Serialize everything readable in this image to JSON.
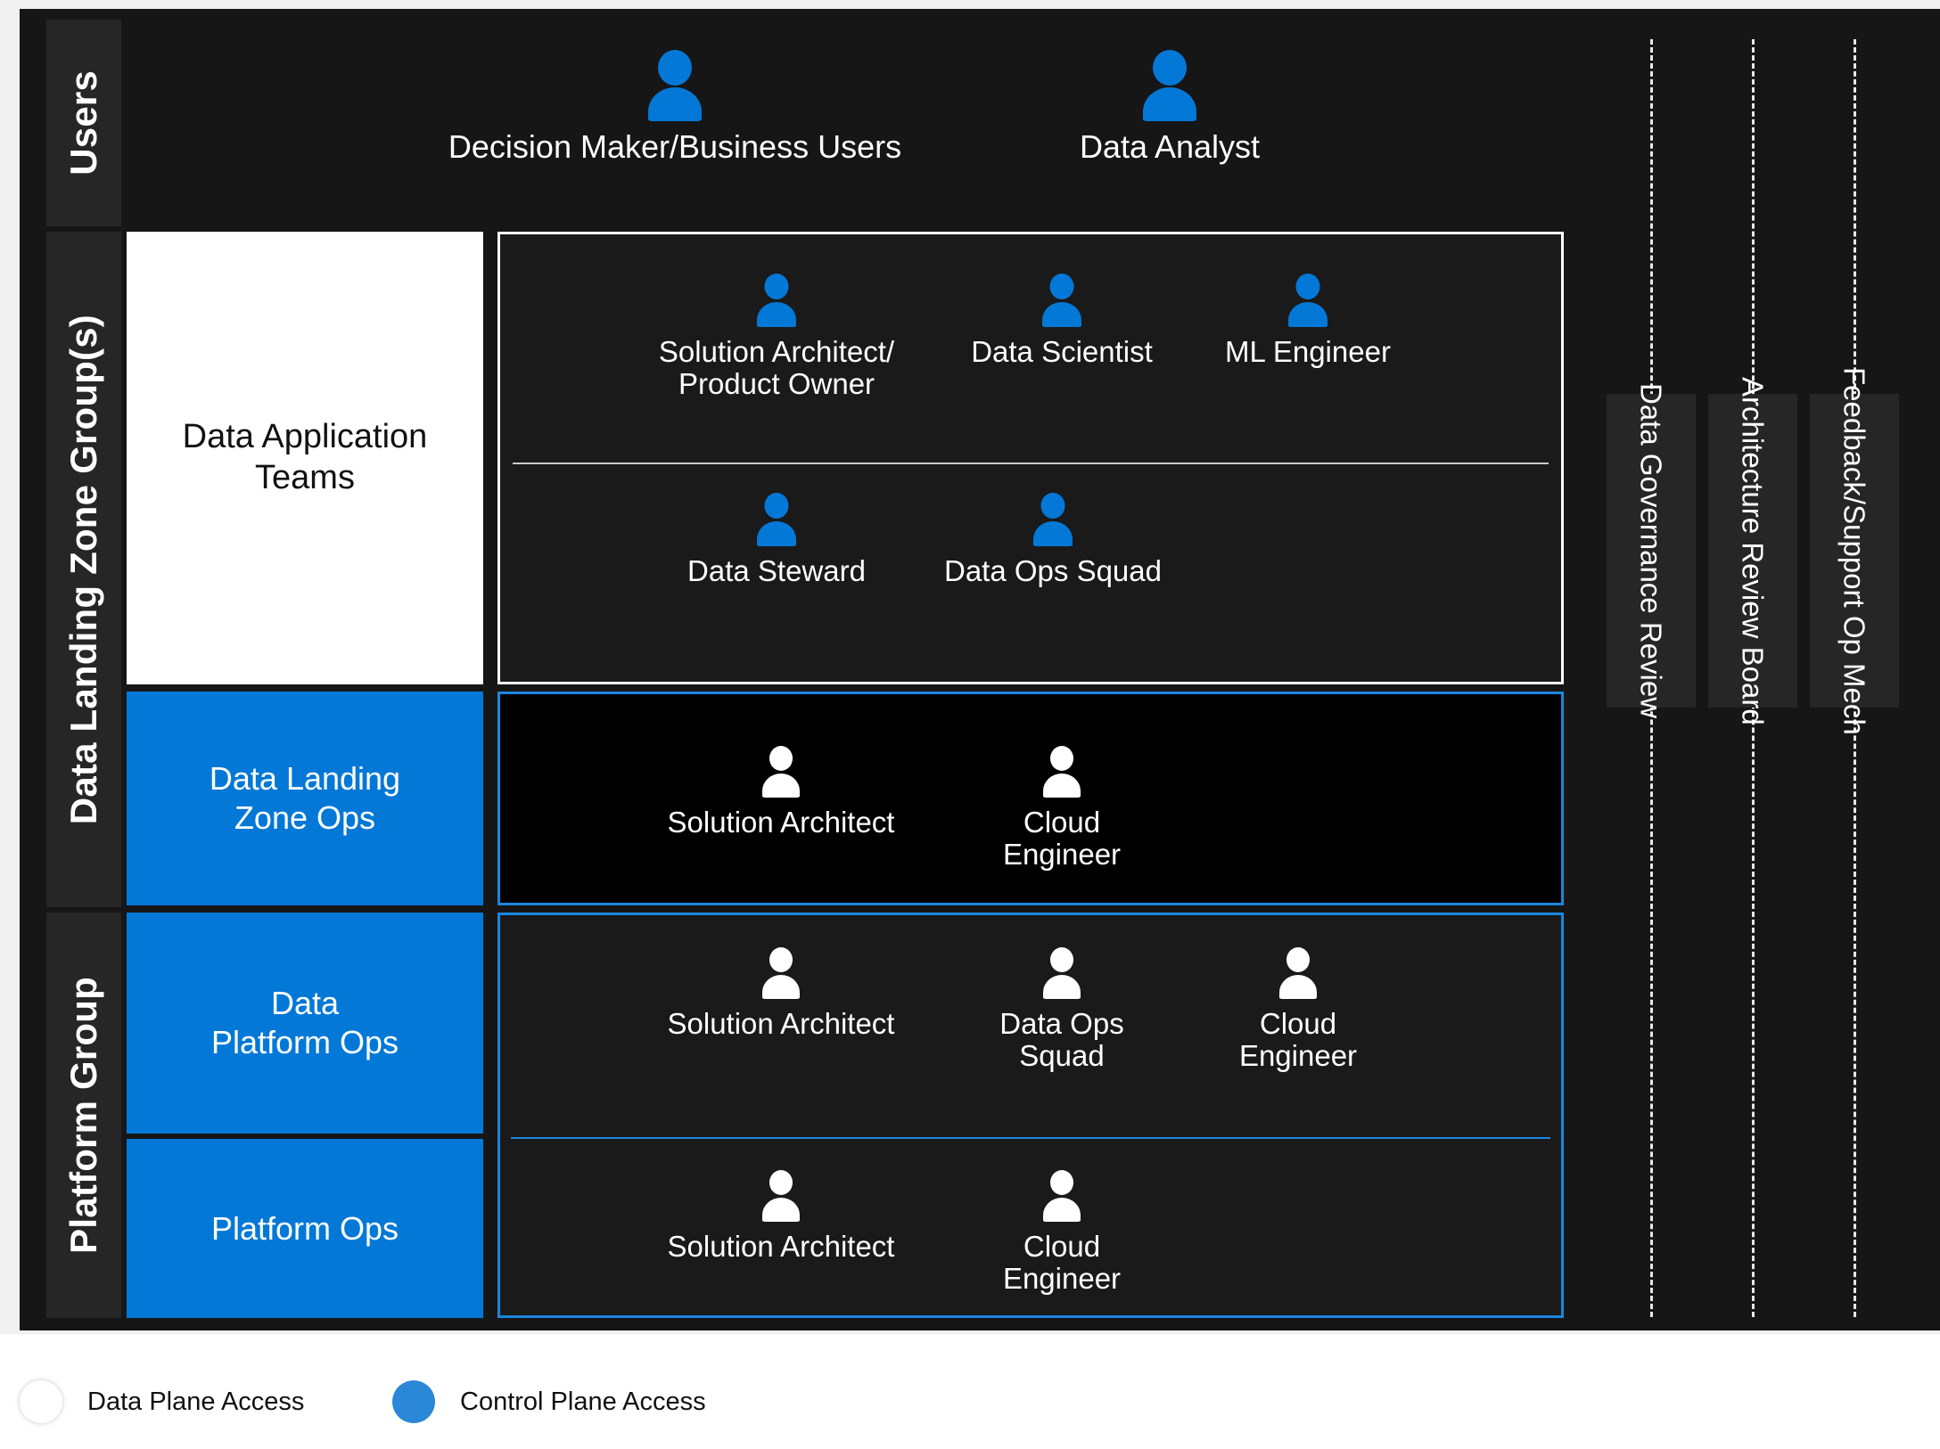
{
  "groups": {
    "users": "Users",
    "data_landing_zone": "Data Landing Zone Group(s)",
    "platform": "Platform Group"
  },
  "users_row": {
    "people": [
      {
        "label": "Decision Maker/Business Users",
        "icon": "person-icon"
      },
      {
        "label": "Data Analyst",
        "icon": "person-icon"
      }
    ]
  },
  "data_application_teams": {
    "tile_label": "Data Application\nTeams",
    "roles_top": [
      {
        "label": "Solution Architect/\nProduct Owner",
        "icon": "person-icon"
      },
      {
        "label": "Data Scientist",
        "icon": "person-icon"
      },
      {
        "label": "ML Engineer",
        "icon": "person-icon"
      }
    ],
    "roles_bottom": [
      {
        "label": "Data Steward",
        "icon": "person-icon"
      },
      {
        "label": "Data Ops Squad",
        "icon": "person-icon"
      }
    ]
  },
  "data_landing_zone_ops": {
    "tile_label": "Data Landing\nZone Ops",
    "roles": [
      {
        "label": "Solution Architect",
        "icon": "person-icon"
      },
      {
        "label": "Cloud\nEngineer",
        "icon": "person-icon"
      }
    ]
  },
  "data_platform_ops": {
    "tile_label": "Data\nPlatform Ops",
    "roles": [
      {
        "label": "Solution Architect",
        "icon": "person-icon"
      },
      {
        "label": "Data Ops\nSquad",
        "icon": "person-icon"
      },
      {
        "label": "Cloud\nEngineer",
        "icon": "person-icon"
      }
    ]
  },
  "platform_ops": {
    "tile_label": "Platform Ops",
    "roles": [
      {
        "label": "Solution Architect",
        "icon": "person-icon"
      },
      {
        "label": "Cloud\nEngineer",
        "icon": "person-icon"
      }
    ]
  },
  "review_panels": [
    {
      "label": "Data Governance Review"
    },
    {
      "label": "Architecture Review Board"
    },
    {
      "label": "Feedback/Support Op Mech"
    }
  ],
  "legend": {
    "items": [
      {
        "label": "Data Plane Access",
        "color": "#ffffff"
      },
      {
        "label": "Control Plane Access",
        "color": "#2b87d8"
      }
    ]
  },
  "colors": {
    "accent_blue": "#0478d7",
    "border_blue": "#1a86e0",
    "background": "#161616",
    "panel": "#1a1a1a",
    "sidebar": "#262626",
    "white": "#ffffff"
  }
}
